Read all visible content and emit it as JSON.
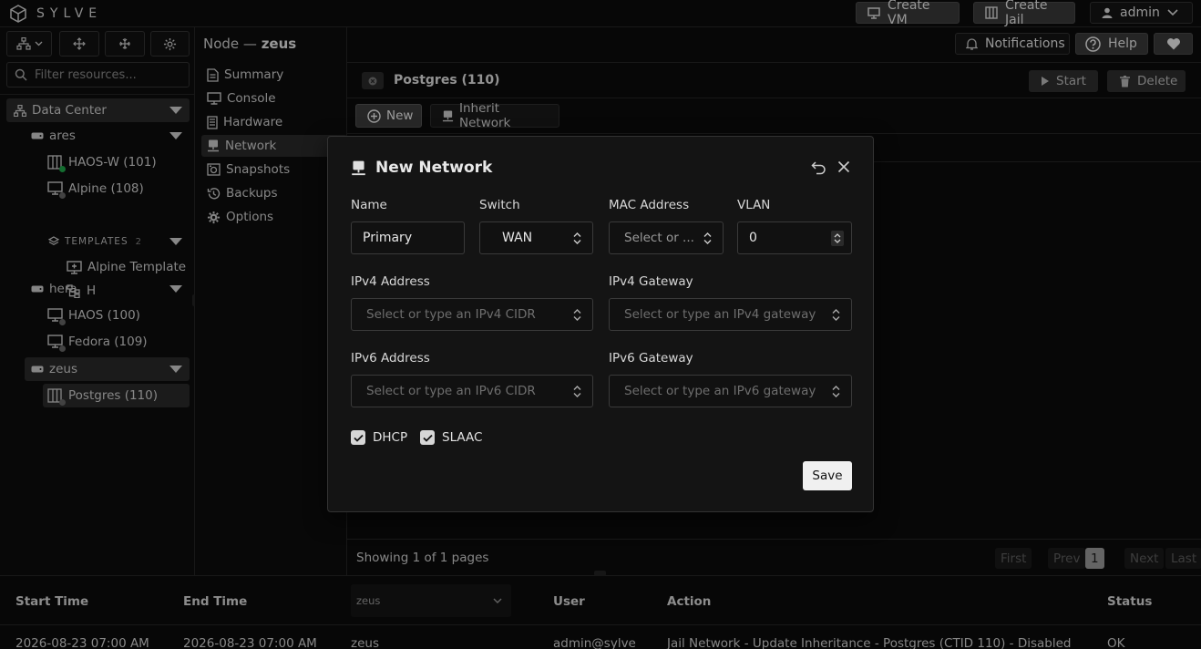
{
  "app": {
    "brand": "SYLVE"
  },
  "topbar": {
    "create_vm": "Create VM",
    "create_jail": "Create Jail",
    "user": "admin"
  },
  "header": {
    "node_prefix": "Node —",
    "node_name": "zeus",
    "notifications": "Notifications",
    "help": "Help"
  },
  "sidebar": {
    "filter_placeholder": "Filter resources...",
    "datacenter": "Data Center",
    "nodes": [
      {
        "name": "ares",
        "items": [
          "HAOS-W (101)",
          "Alpine (108)"
        ],
        "templates_label": "TEMPLATES",
        "templates_count": "2",
        "templates": [
          "Alpine Template",
          "H"
        ]
      },
      {
        "name": "hera",
        "items": [
          "HAOS (100)",
          "Fedora (109)"
        ]
      },
      {
        "name": "zeus",
        "items": [
          "Postgres (110)"
        ]
      }
    ]
  },
  "nav": {
    "items": [
      "Summary",
      "Console",
      "Hardware",
      "Network",
      "Snapshots",
      "Backups",
      "Options"
    ]
  },
  "content": {
    "title": "Postgres (110)",
    "start": "Start",
    "delete": "Delete",
    "new": "New",
    "inherit": "Inherit Network",
    "pager_text": "Showing 1 of 1 pages",
    "first": "First",
    "prev": "Prev",
    "page": "1",
    "next": "Next",
    "last": "Last"
  },
  "modal": {
    "title": "New Network",
    "name_label": "Name",
    "name_value": "Primary",
    "switch_label": "Switch",
    "switch_value": "WAN",
    "mac_label": "MAC Address",
    "mac_placeholder": "Select or ...",
    "vlan_label": "VLAN",
    "vlan_value": "0",
    "ipv4_label": "IPv4 Address",
    "ipv4_placeholder": "Select or type an IPv4 CIDR",
    "ipv4gw_label": "IPv4 Gateway",
    "ipv4gw_placeholder": "Select or type an IPv4 gateway",
    "ipv6_label": "IPv6 Address",
    "ipv6_placeholder": "Select or type an IPv6 CIDR",
    "ipv6gw_label": "IPv6 Gateway",
    "ipv6gw_placeholder": "Select or type an IPv6 gateway",
    "dhcp": "DHCP",
    "slaac": "SLAAC",
    "save": "Save"
  },
  "log": {
    "headers": [
      "Start Time",
      "End Time",
      "User",
      "Action",
      "Status"
    ],
    "node_filter": "zeus",
    "row": {
      "start": "2026-08-23 07:00 AM",
      "end": "2026-08-23 07:00 AM",
      "node": "zeus",
      "user": "admin@sylve",
      "action": "Jail Network - Update Inheritance - Postgres (CTID 110) - Disabled",
      "status": "OK"
    }
  },
  "colors": {
    "online": "#1fa84a",
    "offline": "#666666"
  }
}
